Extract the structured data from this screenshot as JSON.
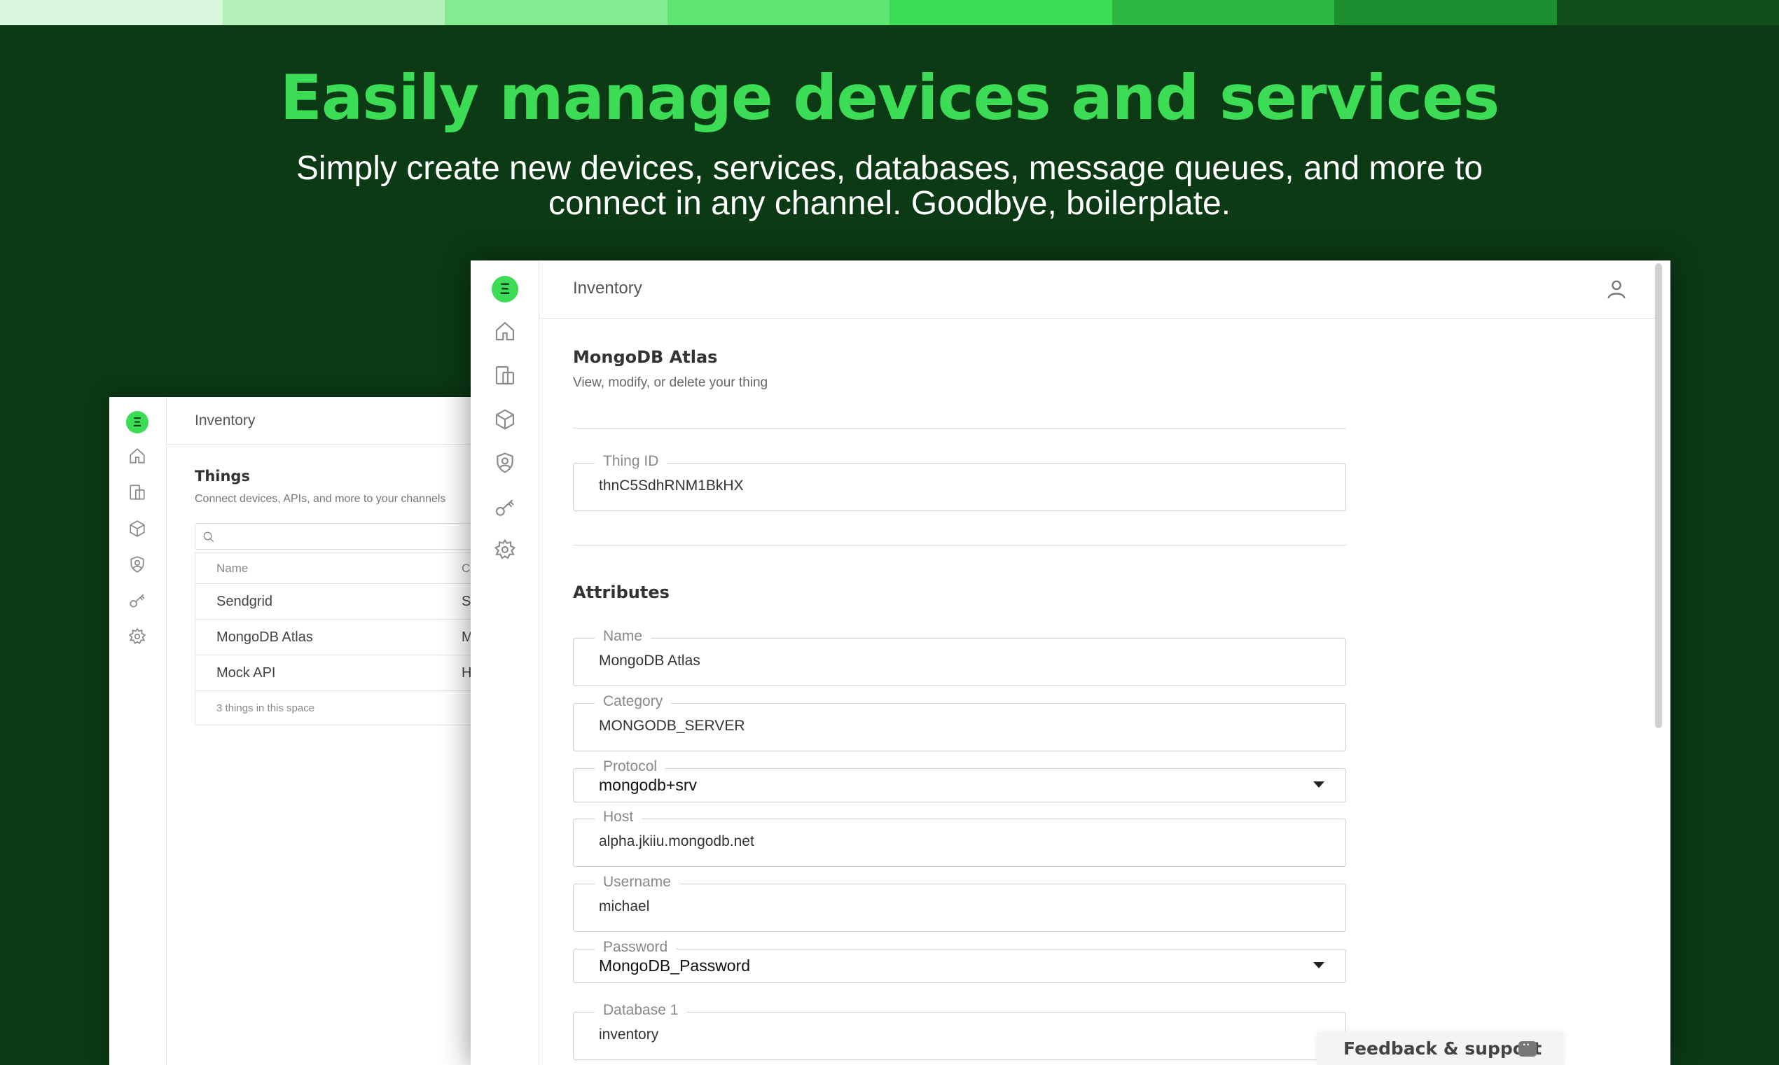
{
  "stripe_colors": [
    "#d8f7dc",
    "#b3f0ba",
    "#85eb92",
    "#5ee670",
    "#3ddc56",
    "#2cb843",
    "#1e8f31",
    "#124f1e"
  ],
  "hero": {
    "title": "Easily manage devices and services",
    "subtitle": "Simply create new devices, services, databases, message queues, and more to connect in any channel. Goodbye, boilerplate."
  },
  "logo_glyph": "Ξ",
  "nav_icons": [
    "home-icon",
    "devices-icon",
    "cube-icon",
    "shield-user-icon",
    "key-icon",
    "gear-icon"
  ],
  "back_window": {
    "header_title": "Inventory",
    "things_title": "Things",
    "things_subtitle": "Connect devices, APIs, and more to your channels",
    "columns": [
      "Name",
      "C"
    ],
    "rows": [
      {
        "name": "Sendgrid",
        "c2": "S"
      },
      {
        "name": "MongoDB Atlas",
        "c2": "M"
      },
      {
        "name": "Mock API",
        "c2": "H"
      }
    ],
    "footer": "3 things in this space"
  },
  "front_window": {
    "header_title": "Inventory",
    "record_title": "MongoDB Atlas",
    "record_subtitle": "View, modify, or delete your thing",
    "thing_id": {
      "label": "Thing ID",
      "value": "thnC5SdhRNM1BkHX"
    },
    "attributes_title": "Attributes",
    "fields": {
      "name": {
        "label": "Name",
        "value": "MongoDB Atlas"
      },
      "category": {
        "label": "Category",
        "value": "MONGODB_SERVER"
      },
      "protocol": {
        "label": "Protocol",
        "value": "mongodb+srv"
      },
      "host": {
        "label": "Host",
        "value": "alpha.jkiiu.mongodb.net"
      },
      "username": {
        "label": "Username",
        "value": "michael"
      },
      "password": {
        "label": "Password",
        "value": "MongoDB_Password"
      },
      "database": {
        "label": "Database 1",
        "value": "inventory"
      }
    }
  },
  "feedback": {
    "label": "Feedback & support"
  }
}
